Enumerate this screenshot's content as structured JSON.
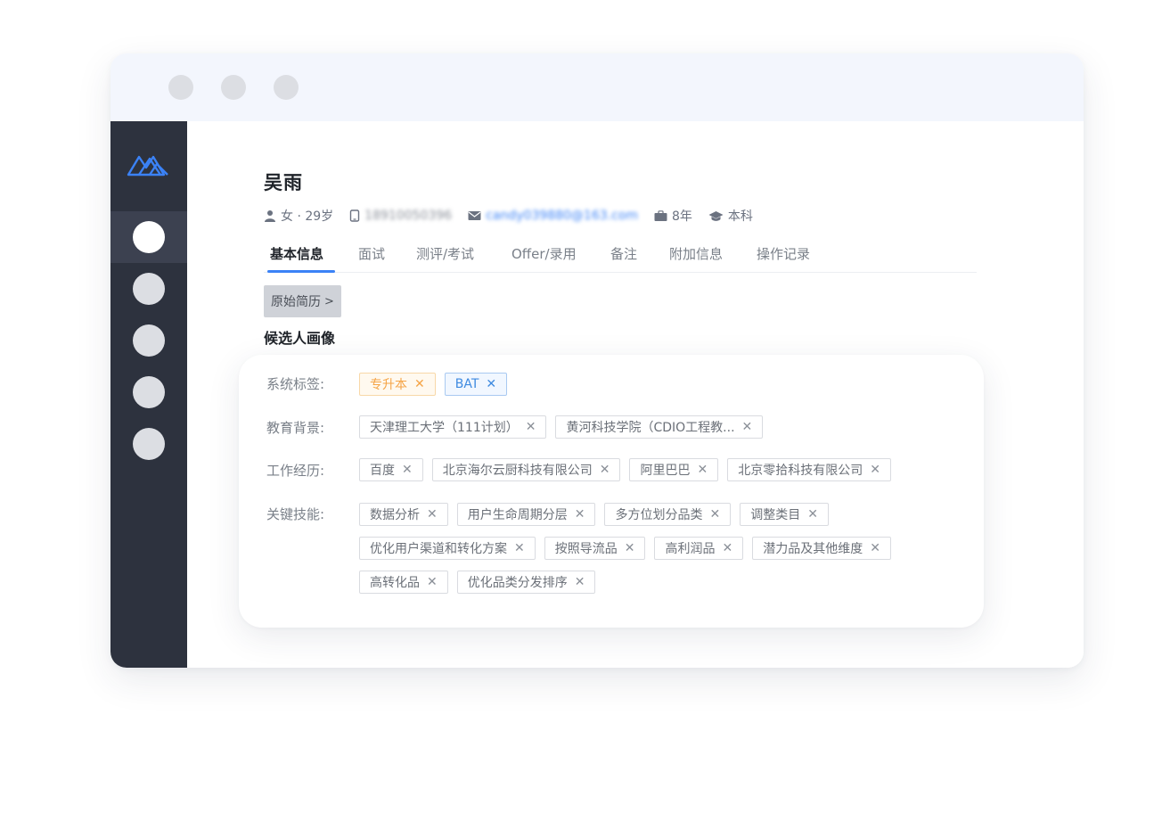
{
  "candidate": {
    "name": "吴雨",
    "gender_age": "女 · 29岁",
    "phone": "18910050396",
    "email": "candy039880@163.com",
    "experience": "8年",
    "degree": "本科"
  },
  "tabs": [
    "基本信息",
    "面试",
    "测评/考试",
    "Offer/录用",
    "备注",
    "附加信息",
    "操作记录"
  ],
  "resume_button": {
    "label": "原始简历",
    "chevron": ">"
  },
  "section_title": "候选人画像",
  "tag_close_glyph": "✕",
  "profile": {
    "system_tags": {
      "label": "系统标签:",
      "tags": [
        {
          "text": "专升本",
          "color": "#f5a446"
        },
        {
          "text": "BAT",
          "color": "#3e8ae0"
        }
      ]
    },
    "education": {
      "label": "教育背景:",
      "tags": [
        "天津理工大学（111计划）",
        "黄河科技学院（CDIO工程教..."
      ]
    },
    "work": {
      "label": "工作经历:",
      "tags": [
        "百度",
        "北京海尔云厨科技有限公司",
        "阿里巴巴",
        "北京零拾科技有限公司"
      ]
    },
    "skills": {
      "label": "关键技能:",
      "lines": [
        [
          "数据分析",
          "用户生命周期分层",
          "多方位划分品类",
          "调整类目"
        ],
        [
          "优化用户渠道和转化方案",
          "按照导流品",
          "高利润品",
          "潜力品及其他维度"
        ],
        [
          "高转化品",
          "优化品类分发排序"
        ]
      ]
    }
  },
  "colors": {
    "sidebar": "#2d323e",
    "accent": "#3b82f6",
    "titlebar": "#f3f6fd"
  },
  "icons": [
    "user-icon",
    "phone-icon",
    "mail-icon",
    "briefcase-icon",
    "graduation-cap-icon",
    "app-logo-icon"
  ]
}
